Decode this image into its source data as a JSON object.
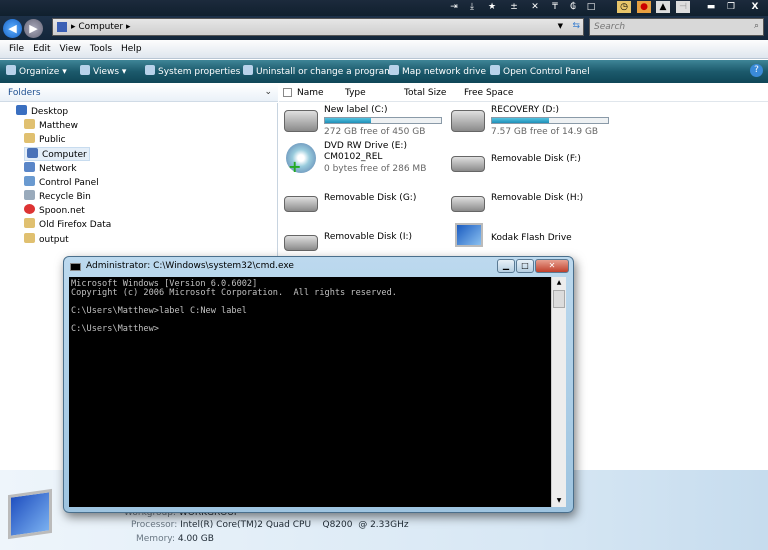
{
  "address": {
    "path": "Computer",
    "search_placeholder": "Search"
  },
  "menu": [
    "File",
    "Edit",
    "View",
    "Tools",
    "Help"
  ],
  "toolbar": {
    "organize": "Organize",
    "views": "Views",
    "system_properties": "System properties",
    "uninstall": "Uninstall or change a program",
    "map_drive": "Map network drive",
    "control_panel": "Open Control Panel"
  },
  "folders_label": "Folders",
  "tree": [
    "Desktop",
    "Matthew",
    "Public",
    "Computer",
    "Network",
    "Control Panel",
    "Recycle Bin",
    "Spoon.net",
    "Old Firefox Data",
    "output"
  ],
  "columns": [
    "Name",
    "Type",
    "Total Size",
    "Free Space"
  ],
  "drives": [
    {
      "name": "New label (C:)",
      "free": "272 GB free of 450 GB",
      "used_percent": 39.6
    },
    {
      "name": "RECOVERY (D:)",
      "free": "7.57 GB free of 14.9 GB",
      "used_percent": 49.2
    },
    {
      "name": "DVD RW Drive (E:)",
      "sub": "CM0102_REL",
      "free": "0 bytes free of 286 MB"
    },
    {
      "name": "Removable Disk (F:)"
    },
    {
      "name": "Removable Disk (G:)"
    },
    {
      "name": "Removable Disk (H:)"
    },
    {
      "name": "Removable Disk (I:)"
    },
    {
      "name": "Kodak Flash Drive"
    }
  ],
  "details": {
    "workgroup_label": "Workgroup:",
    "workgroup": "WORKGROUP",
    "processor_label": "Processor:",
    "processor": "Intel(R) Core(TM)2 Quad CPU    Q8200  @ 2.33GHz",
    "memory_label": "Memory:",
    "memory": "4.00 GB"
  },
  "cmd": {
    "title": "Administrator: C:\\Windows\\system32\\cmd.exe",
    "output": "Microsoft Windows [Version 6.0.6002]\nCopyright (c) 2006 Microsoft Corporation.  All rights reserved.\n\nC:\\Users\\Matthew>label C:New label\n\nC:\\Users\\Matthew>"
  }
}
